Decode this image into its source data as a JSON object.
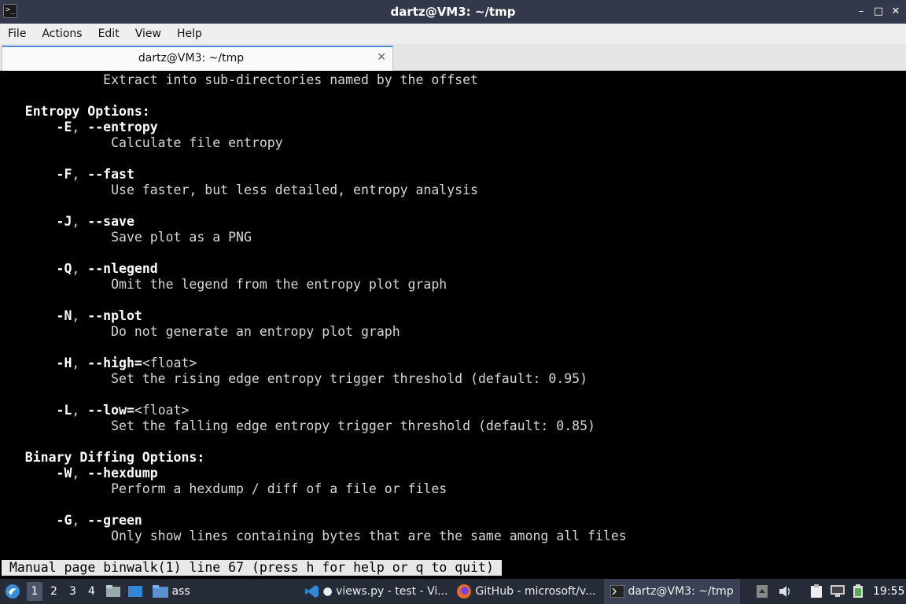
{
  "window": {
    "title": "dartz@VM3: ~/tmp",
    "controls": [
      "–",
      "□",
      "✕"
    ]
  },
  "menu": [
    "File",
    "Actions",
    "Edit",
    "View",
    "Help"
  ],
  "tab": {
    "label": "dartz@VM3: ~/tmp",
    "close": "✕"
  },
  "terminal": {
    "lines": [
      {
        "plain": "             Extract into sub-directories named by the offset"
      },
      {
        "plain": ""
      },
      {
        "bold": "   Entropy Options:"
      },
      {
        "bold": "       -E",
        "plain": ", ",
        "bold2": "--entropy"
      },
      {
        "plain": "              Calculate file entropy"
      },
      {
        "plain": ""
      },
      {
        "bold": "       -F",
        "plain": ", ",
        "bold2": "--fast"
      },
      {
        "plain": "              Use faster, but less detailed, entropy analysis"
      },
      {
        "plain": ""
      },
      {
        "bold": "       -J",
        "plain": ", ",
        "bold2": "--save"
      },
      {
        "plain": "              Save plot as a PNG"
      },
      {
        "plain": ""
      },
      {
        "bold": "       -Q",
        "plain": ", ",
        "bold2": "--nlegend"
      },
      {
        "plain": "              Omit the legend from the entropy plot graph"
      },
      {
        "plain": ""
      },
      {
        "bold": "       -N",
        "plain": ", ",
        "bold2": "--nplot"
      },
      {
        "plain": "              Do not generate an entropy plot graph"
      },
      {
        "plain": ""
      },
      {
        "bold": "       -H",
        "plain": ", ",
        "bold2": "--high=",
        "tail": "<float>"
      },
      {
        "plain": "              Set the rising edge entropy trigger threshold (default: 0.95)"
      },
      {
        "plain": ""
      },
      {
        "bold": "       -L",
        "plain": ", ",
        "bold2": "--low=",
        "tail": "<float>"
      },
      {
        "plain": "              Set the falling edge entropy trigger threshold (default: 0.85)"
      },
      {
        "plain": ""
      },
      {
        "bold": "   Binary Diffing Options:"
      },
      {
        "bold": "       -W",
        "plain": ", ",
        "bold2": "--hexdump"
      },
      {
        "plain": "              Perform a hexdump / diff of a file or files"
      },
      {
        "plain": ""
      },
      {
        "bold": "       -G",
        "plain": ", ",
        "bold2": "--green"
      },
      {
        "plain": "              Only show lines containing bytes that are the same among all files"
      }
    ],
    "status": "Manual page binwalk(1) line 67 (press h for help or q to quit)"
  },
  "taskbar": {
    "workspaces": [
      "1",
      "2",
      "3",
      "4"
    ],
    "active_workspace": "1",
    "folder_label": "ass",
    "tasks": [
      {
        "label": "● views.py - test - Vi...",
        "icon": "vscode-icon",
        "color": "#2f87d6"
      },
      {
        "label": "GitHub - microsoft/v...",
        "icon": "firefox-icon",
        "color": "#e8692b"
      },
      {
        "label": "dartz@VM3: ~/tmp",
        "icon": "terminal-icon",
        "color": "#aaaaaa"
      }
    ],
    "clock": "19:55"
  }
}
